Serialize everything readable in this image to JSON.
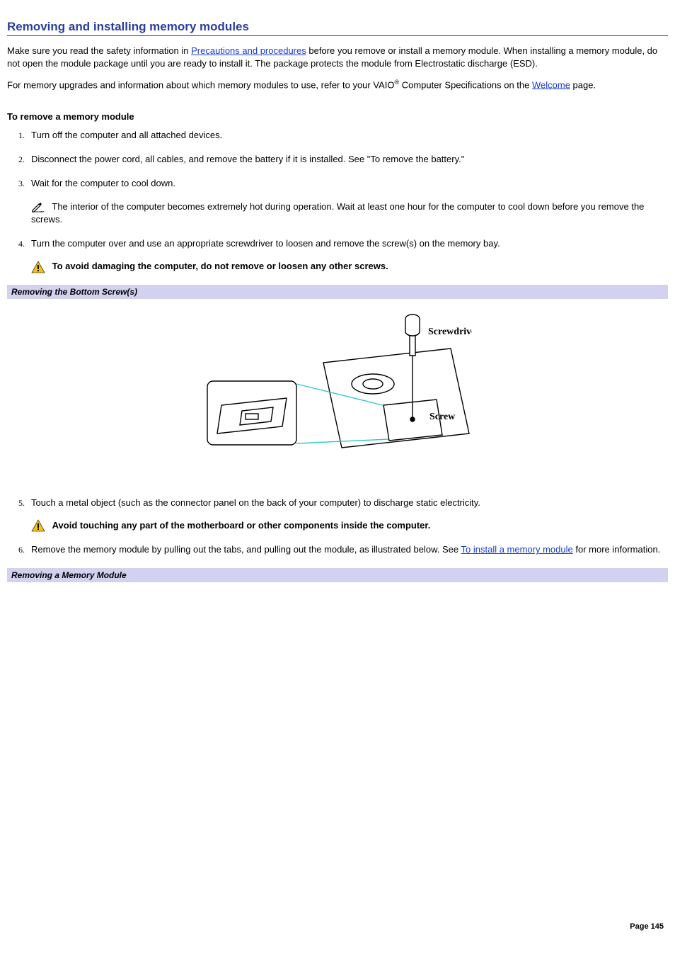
{
  "title": "Removing and installing memory modules",
  "intro1_a": "Make sure you read the safety information in ",
  "link_precautions": "Precautions and procedures",
  "intro1_b": " before you remove or install a memory module. When installing a memory module, do not open the module package until you are ready to install it. The package protects the module from Electrostatic discharge (ESD).",
  "intro2_a": "For memory upgrades and information about which memory modules to use, refer to your VAIO",
  "intro2_reg": "®",
  "intro2_b": " Computer Specifications on the ",
  "link_welcome": "Welcome",
  "intro2_c": " page.",
  "subhead_remove": "To remove a memory module",
  "steps": {
    "s1": "Turn off the computer and all attached devices.",
    "s2": "Disconnect the power cord, all cables, and remove the battery if it is installed. See \"To remove the battery.\"",
    "s3": "Wait for the computer to cool down.",
    "s3_note": " The interior of the computer becomes extremely hot during operation. Wait at least one hour for the computer to cool down before you remove the screws.",
    "s4": "Turn the computer over and use an appropriate screwdriver to loosen and remove the screw(s) on the memory bay.",
    "s4_warn": "To avoid damaging the computer, do not remove or loosen any other screws.",
    "s5": "Touch a metal object (such as the connector panel on the back of your computer) to discharge static electricity.",
    "s5_warn": "Avoid touching any part of the motherboard or other components inside the computer.",
    "s6_a": "Remove the memory module by pulling out the tabs, and pulling out the module, as illustrated below. See ",
    "s6_link": "To install a memory module",
    "s6_b": " for more information."
  },
  "fig1_caption": "Removing the Bottom Screw(s)",
  "fig1_label_screwdriver": "Screwdriver",
  "fig1_label_screw": "Screw",
  "fig2_caption": "Removing a Memory Module",
  "page_footer": "Page 145"
}
